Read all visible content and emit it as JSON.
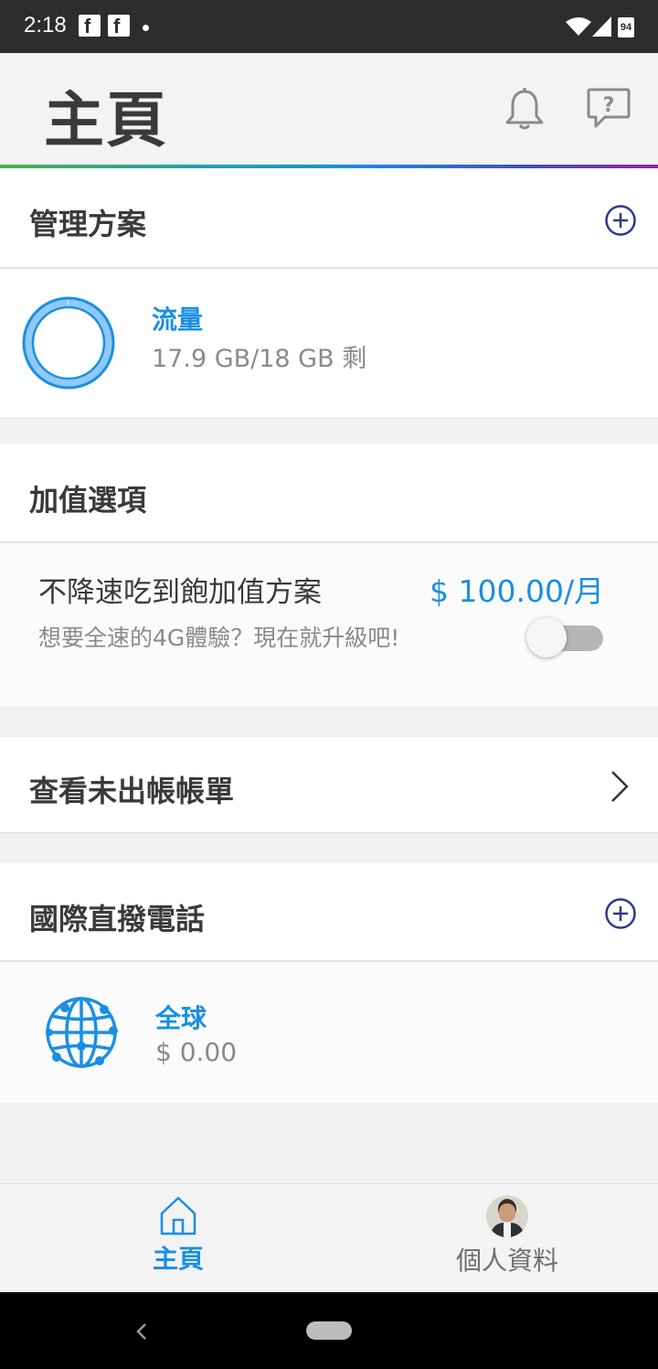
{
  "status_bar": {
    "time": "2:18",
    "battery": "94"
  },
  "header": {
    "title": "主頁"
  },
  "plan": {
    "title": "管理方案",
    "usage_label": "流量",
    "usage_value": "17.9 GB/18 GB 剩",
    "remaining_fraction": 0.994
  },
  "addons": {
    "title": "加值選項",
    "item_name": "不降速吃到飽加值方案",
    "item_price": "$ 100.00/月",
    "item_desc": "想要全速的4G體驗？現在就升級吧!",
    "enabled": false
  },
  "bill": {
    "title": "查看未出帳帳單"
  },
  "idd": {
    "title": "國際直撥電話",
    "region_label": "全球",
    "region_value": "$ 0.00"
  },
  "bottom_nav": {
    "items": [
      {
        "label": "主頁",
        "active": true
      },
      {
        "label": "個人資料",
        "active": false
      }
    ]
  },
  "colors": {
    "accent": "#1a8fe3",
    "navy": "#2b3a8c",
    "text": "#3a3a3a"
  }
}
